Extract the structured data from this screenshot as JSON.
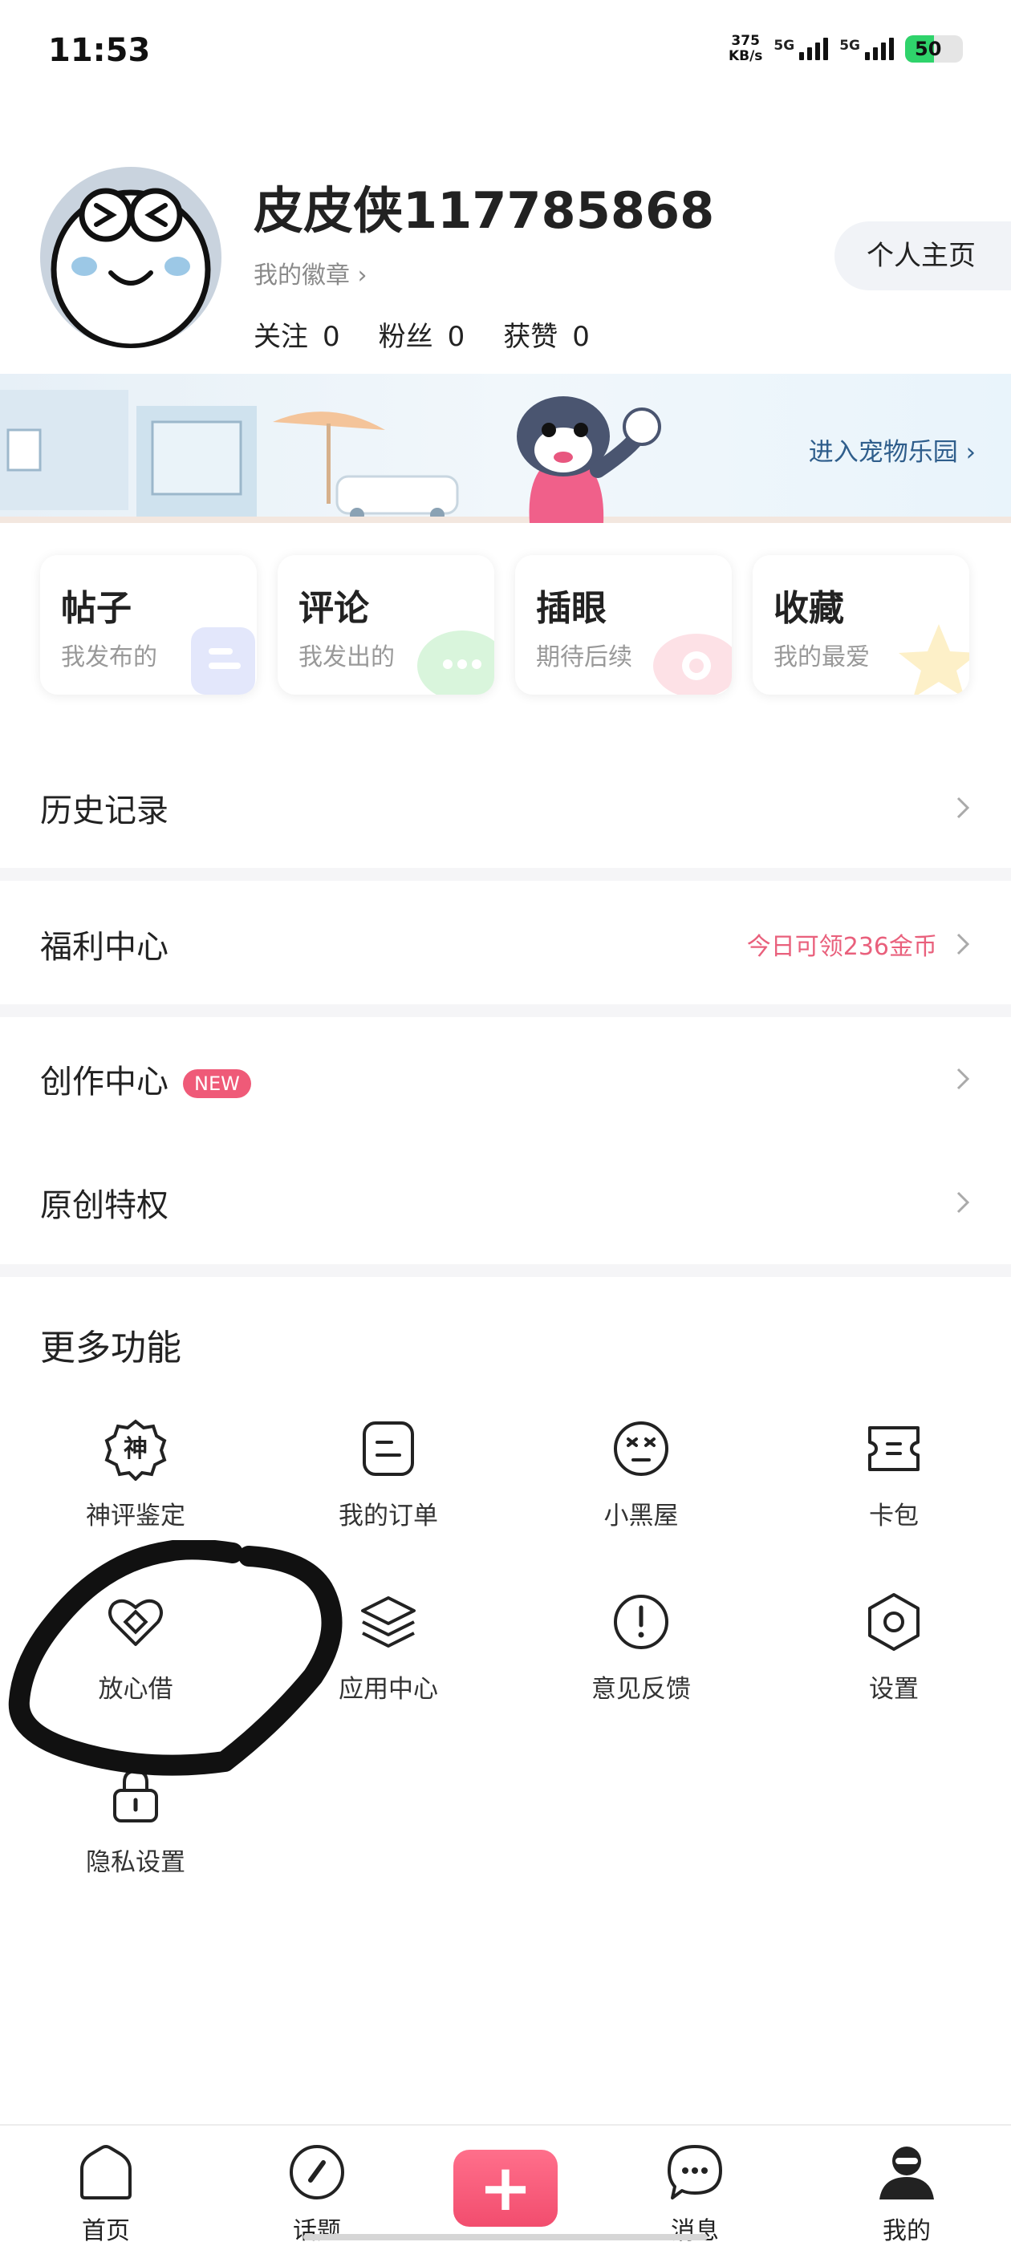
{
  "status_bar": {
    "time": "11:53",
    "net_speed_value": "375",
    "net_speed_unit": "KB/s",
    "signal_1_label": "5G",
    "signal_2_label": "5G",
    "battery": "50"
  },
  "profile": {
    "username": "皮皮侠117785868",
    "badge_link": "我的徽章 ›",
    "following_label": "关注",
    "following_count": "0",
    "followers_label": "粉丝",
    "followers_count": "0",
    "likes_label": "获赞",
    "likes_count": "0",
    "homepage_button": "个人主页"
  },
  "banner": {
    "text": "进入宠物乐园"
  },
  "quick_cards": [
    {
      "title": "帖子",
      "subtitle": "我发布的"
    },
    {
      "title": "评论",
      "subtitle": "我发出的"
    },
    {
      "title": "插眼",
      "subtitle": "期待后续"
    },
    {
      "title": "收藏",
      "subtitle": "我的最爱"
    }
  ],
  "rows": {
    "history": {
      "label": "历史记录"
    },
    "welfare": {
      "label": "福利中心",
      "right_text": "今日可领236金币"
    },
    "creation": {
      "label": "创作中心",
      "badge": "NEW"
    },
    "original": {
      "label": "原创特权"
    }
  },
  "more": {
    "title": "更多功能",
    "items": [
      {
        "label": "神评鉴定",
        "icon": "god-comment-icon"
      },
      {
        "label": "我的订单",
        "icon": "order-icon"
      },
      {
        "label": "小黑屋",
        "icon": "blackroom-icon"
      },
      {
        "label": "卡包",
        "icon": "card-wallet-icon"
      },
      {
        "label": "放心借",
        "icon": "loan-icon"
      },
      {
        "label": "应用中心",
        "icon": "layers-icon"
      },
      {
        "label": "意见反馈",
        "icon": "feedback-icon"
      },
      {
        "label": "设置",
        "icon": "settings-icon"
      },
      {
        "label": "隐私设置",
        "icon": "lock-icon"
      }
    ]
  },
  "bottom_nav": {
    "home": "首页",
    "topics": "话题",
    "post": "+",
    "messages": "消息",
    "mine": "我的"
  },
  "colors": {
    "accent_pink": "#f24d6e",
    "welfare_text": "#e9607c",
    "banner_link": "#2f5e8c",
    "battery_green": "#2fd36b"
  }
}
